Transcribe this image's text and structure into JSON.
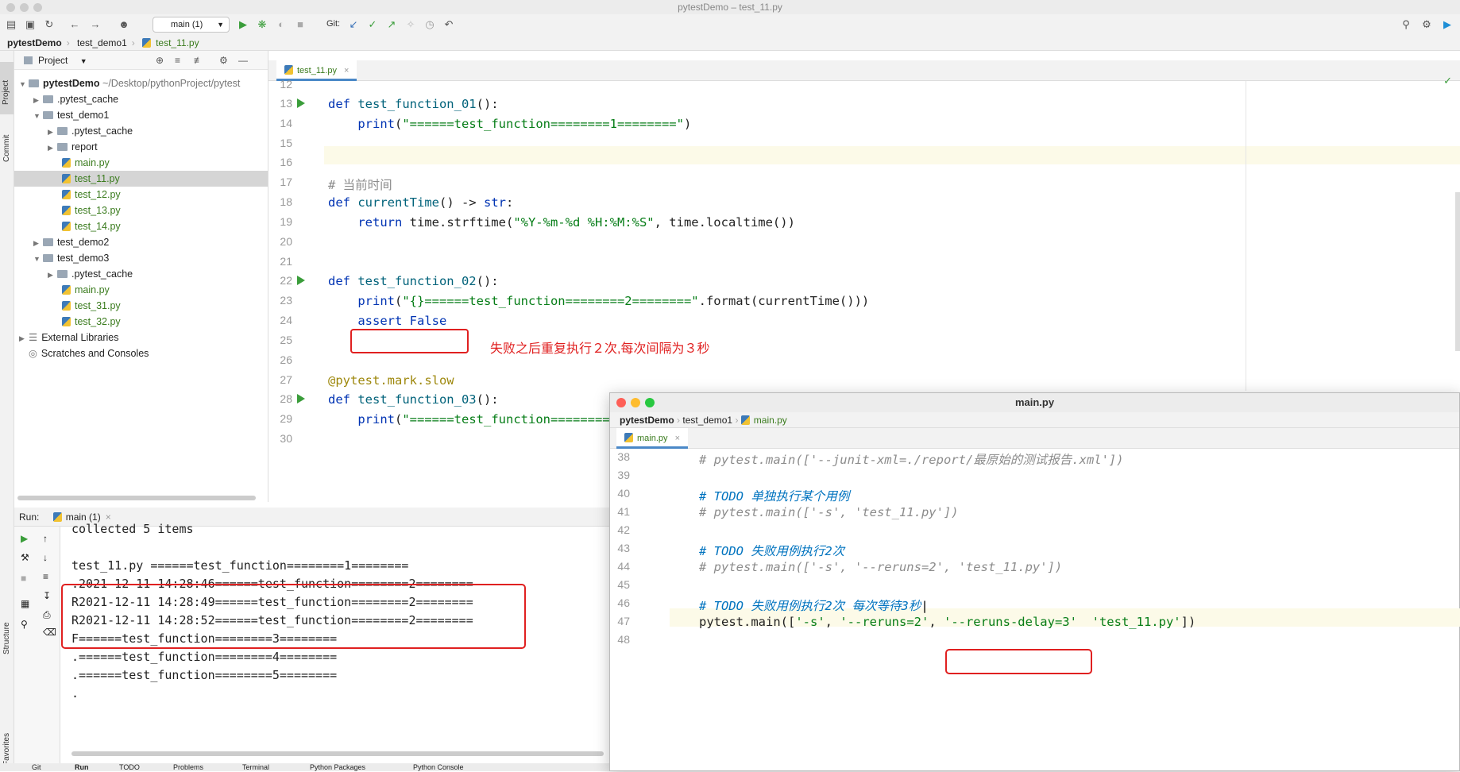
{
  "window": {
    "title": "pytestDemo – test_11.py"
  },
  "toolbar": {
    "run_config": "main (1)",
    "git_label": "Git:"
  },
  "breadcrumb": [
    "pytestDemo",
    "test_demo1",
    "test_11.py"
  ],
  "left_stripe": {
    "project": "Project",
    "commit": "Commit",
    "structure": "Structure",
    "favorites": "Favorites"
  },
  "project": {
    "header": "Project",
    "root_label": "pytestDemo",
    "root_path": "~/Desktop/pythonProject/pytest",
    "items": [
      {
        "label": ".pytest_cache"
      },
      {
        "label": "test_demo1"
      },
      {
        "label": ".pytest_cache"
      },
      {
        "label": "report"
      },
      {
        "label": "main.py"
      },
      {
        "label": "test_11.py"
      },
      {
        "label": "test_12.py"
      },
      {
        "label": "test_13.py"
      },
      {
        "label": "test_14.py"
      },
      {
        "label": "test_demo2"
      },
      {
        "label": "test_demo3"
      },
      {
        "label": ".pytest_cache"
      },
      {
        "label": "main.py"
      },
      {
        "label": "test_31.py"
      },
      {
        "label": "test_32.py"
      },
      {
        "label": "External Libraries"
      },
      {
        "label": "Scratches and Consoles"
      }
    ]
  },
  "editor": {
    "tab": "test_11.py",
    "annotation": "失败之后重复执行２次,每次间隔为３秒"
  },
  "run": {
    "label": "Run:",
    "tab": "main (1)",
    "console": [
      "collected 5 items",
      "",
      "test_11.py ======test_function========1========",
      ".2021-12-11 14:28:46======test_function========2========",
      "R2021-12-11 14:28:49======test_function========2========",
      "R2021-12-11 14:28:52======test_function========2========",
      "F======test_function========3========",
      ".======test_function========4========",
      ".======test_function========5========",
      "."
    ]
  },
  "float_window": {
    "title": "main.py",
    "breadcrumb": [
      "pytestDemo",
      "test_demo1",
      "main.py"
    ],
    "tab": "main.py"
  },
  "bottom_tabs": [
    "Git",
    "Run",
    "TODO",
    "Problems",
    "Terminal",
    "Python Packages",
    "Python Console"
  ]
}
